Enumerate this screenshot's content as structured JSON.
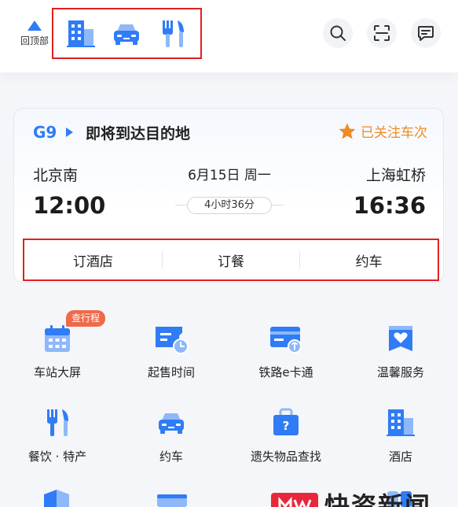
{
  "header": {
    "back_to_top_label": "回顶部",
    "quick_icons": [
      "building-icon",
      "car-icon",
      "fork-knife-icon"
    ],
    "right_buttons": [
      "search-icon",
      "scan-icon",
      "message-icon"
    ]
  },
  "trip": {
    "train_number": "G9",
    "status": "即将到达目的地",
    "follow_label": "已关注车次",
    "from_station": "北京南",
    "to_station": "上海虹桥",
    "date": "6月15日 周一",
    "from_time": "12:00",
    "to_time": "16:36",
    "duration": "4小时36分",
    "actions": [
      "订酒店",
      "订餐",
      "约车"
    ]
  },
  "services": {
    "badge": "查行程",
    "items": [
      {
        "label": "车站大屏",
        "icon": "calendar-icon"
      },
      {
        "label": "起售时间",
        "icon": "ticket-clock-icon"
      },
      {
        "label": "铁路e卡通",
        "icon": "card-icon"
      },
      {
        "label": "温馨服务",
        "icon": "heart-icon"
      },
      {
        "label": "餐饮 · 特产",
        "icon": "fork-knife-icon"
      },
      {
        "label": "约车",
        "icon": "car-icon"
      },
      {
        "label": "遗失物品查找",
        "icon": "lost-bag-icon"
      },
      {
        "label": "酒店",
        "icon": "building-icon"
      }
    ]
  },
  "watermark": {
    "text": "快资新闻"
  },
  "colors": {
    "primary": "#2f7cf6",
    "accent": "#f08a24",
    "highlight": "#e02020",
    "badge": "#f06a4a"
  }
}
